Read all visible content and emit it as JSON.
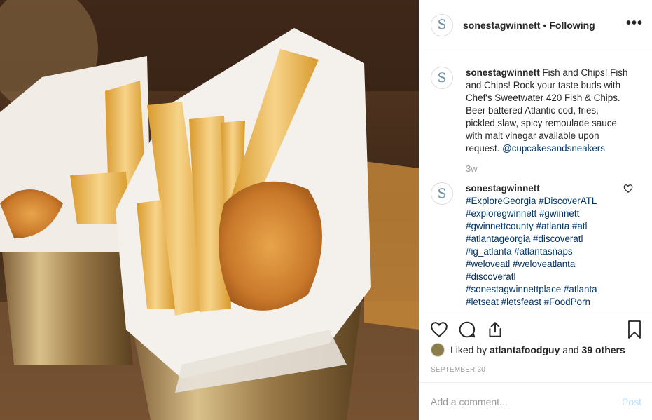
{
  "post": {
    "username": "sonestagwinnett",
    "separator": "•",
    "follow_state": "Following",
    "more_icon": "more-horizontal-icon",
    "avatar_letter": "S"
  },
  "caption": {
    "username": "sonestagwinnett",
    "text": "Fish and Chips! Fish and Chips! Rock your taste buds with Chef's Sweetwater 420 Fish & Chips. Beer battered Atlantic cod, fries, pickled slaw, spicy remoulade sauce with malt vinegar available upon request.",
    "mention": "@cupcakesandsneakers",
    "time": "3w"
  },
  "comment": {
    "username": "sonestagwinnett",
    "hashtags": [
      "#ExploreGeorgia #DiscoverATL",
      "#exploregwinnett #gwinnett",
      "#gwinnettcounty #atlanta #atl",
      "#atlantageorgia #discoveratl",
      "#ig_atlanta #atlantasnaps",
      "#weloveatl #weloveatlanta",
      "#discoveratl",
      "#sonestagwinnettplace #atlanta",
      "#letseat #letsfeast #FoodPorn"
    ]
  },
  "likes": {
    "prefix": "Liked by",
    "user": "atlantafoodguy",
    "connector": "and",
    "others": "39 others"
  },
  "date": "SEPTEMBER 30",
  "add_comment": {
    "placeholder": "Add a comment...",
    "post_label": "Post"
  },
  "colors": {
    "link": "#003569",
    "muted": "#999999",
    "post_disabled": "#b2dffc",
    "border": "#efefef"
  }
}
